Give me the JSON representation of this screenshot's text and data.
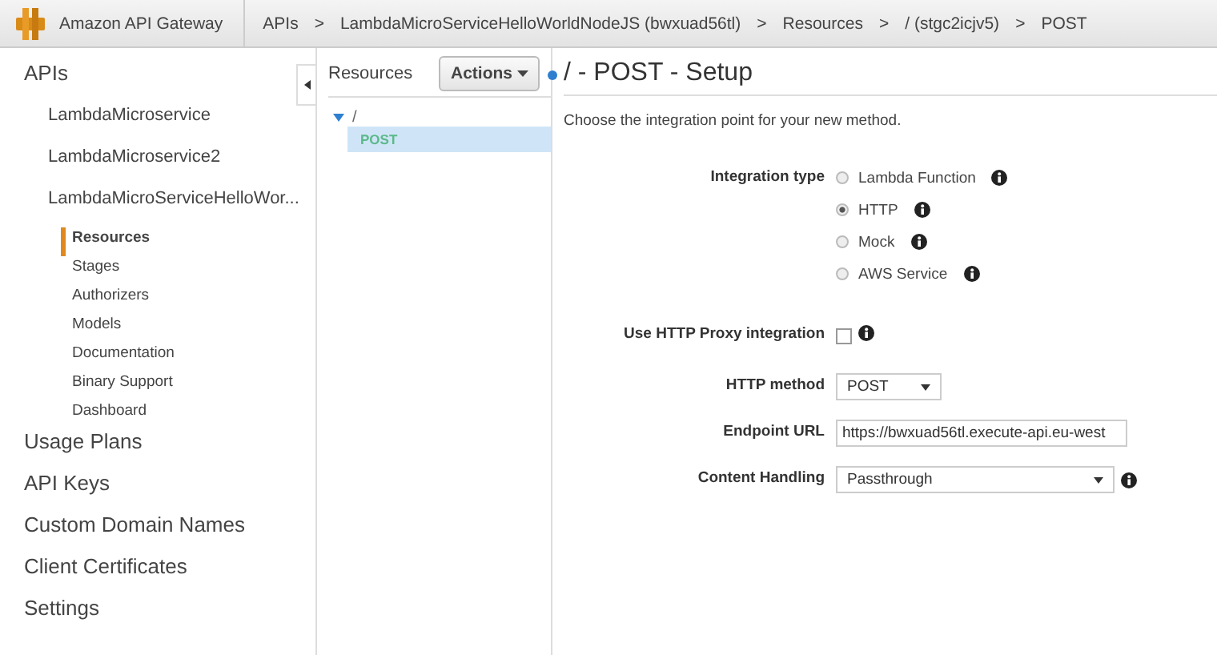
{
  "top_bar": {
    "brand": "Amazon API Gateway",
    "separator": ">",
    "breadcrumbs": [
      "APIs",
      "LambdaMicroServiceHelloWorldNodeJS (bwxuad56tl)",
      "Resources",
      "/ (stgc2icjv5)",
      "POST"
    ]
  },
  "sidebar": {
    "items": [
      {
        "label": "APIs",
        "children": [
          {
            "label": "LambdaMicroservice"
          },
          {
            "label": "LambdaMicroservice2"
          },
          {
            "label": "LambdaMicroServiceHelloWor...",
            "children": [
              {
                "label": "Resources",
                "selected": true
              },
              {
                "label": "Stages",
                "selected": false
              },
              {
                "label": "Authorizers",
                "selected": false
              },
              {
                "label": "Models",
                "selected": false
              },
              {
                "label": "Documentation",
                "selected": false
              },
              {
                "label": "Binary Support",
                "selected": false
              },
              {
                "label": "Dashboard",
                "selected": false
              }
            ]
          }
        ]
      },
      {
        "label": "Usage Plans"
      },
      {
        "label": "API Keys"
      },
      {
        "label": "Custom Domain Names"
      },
      {
        "label": "Client Certificates"
      },
      {
        "label": "Settings"
      }
    ]
  },
  "resources": {
    "title": "Resources",
    "actions_button": "Actions",
    "tree": [
      {
        "label": "/",
        "expanded": true,
        "children": [
          {
            "label": "POST",
            "selected": true
          }
        ]
      }
    ]
  },
  "setup": {
    "title": "/ - POST - Setup",
    "intro": "Choose the integration point for your new method.",
    "fields": [
      {
        "kind": "radio",
        "label": "Integration type",
        "options": [
          {
            "label": "Lambda Function",
            "selected": false
          },
          {
            "label": "HTTP",
            "selected": true
          },
          {
            "label": "Mock",
            "selected": false
          },
          {
            "label": "AWS Service",
            "selected": false
          }
        ]
      },
      {
        "kind": "checkbox",
        "label": "Use HTTP Proxy integration",
        "checked": false
      },
      {
        "kind": "short-select",
        "label": "HTTP method",
        "value": "POST"
      },
      {
        "kind": "input",
        "label": "Endpoint URL",
        "value": "https://bwxuad56tl.execute-api.eu-west"
      },
      {
        "kind": "wide-select",
        "label": "Content Handling",
        "value": "Passthrough"
      }
    ]
  }
}
